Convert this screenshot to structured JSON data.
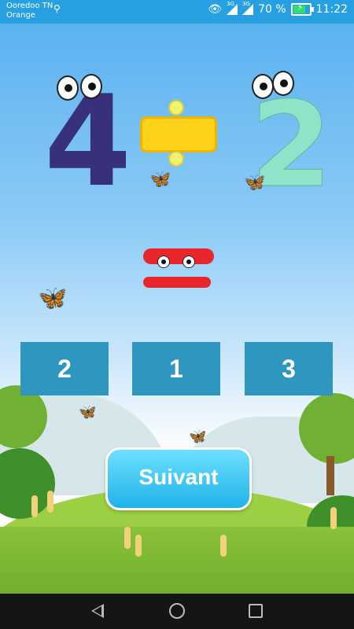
{
  "status_bar": {
    "carrier_line1": "Ooredoo TN",
    "carrier_line2": "Orange",
    "battery_percent": "70 %",
    "time": "11:22",
    "signal1_label": "3G",
    "signal2_label": "3G",
    "battery_level": 0.7,
    "icons": [
      "usb-icon",
      "eye-icon",
      "signal-icon",
      "battery-charging-icon"
    ]
  },
  "question": {
    "left_operand": "4",
    "operator": "divide",
    "right_operand": "2",
    "result_symbol": "equals"
  },
  "answers": [
    "2",
    "1",
    "3"
  ],
  "next_button_label": "Suivant",
  "nav_bar": {
    "icons": [
      "back-icon",
      "home-icon",
      "recent-apps-icon"
    ]
  },
  "colors": {
    "status_bar": "#26a0e0",
    "answer_box": "#2f96bf",
    "next_button": "#1fb3e8",
    "equals": "#e8262b",
    "divide": "#ffd21a"
  }
}
